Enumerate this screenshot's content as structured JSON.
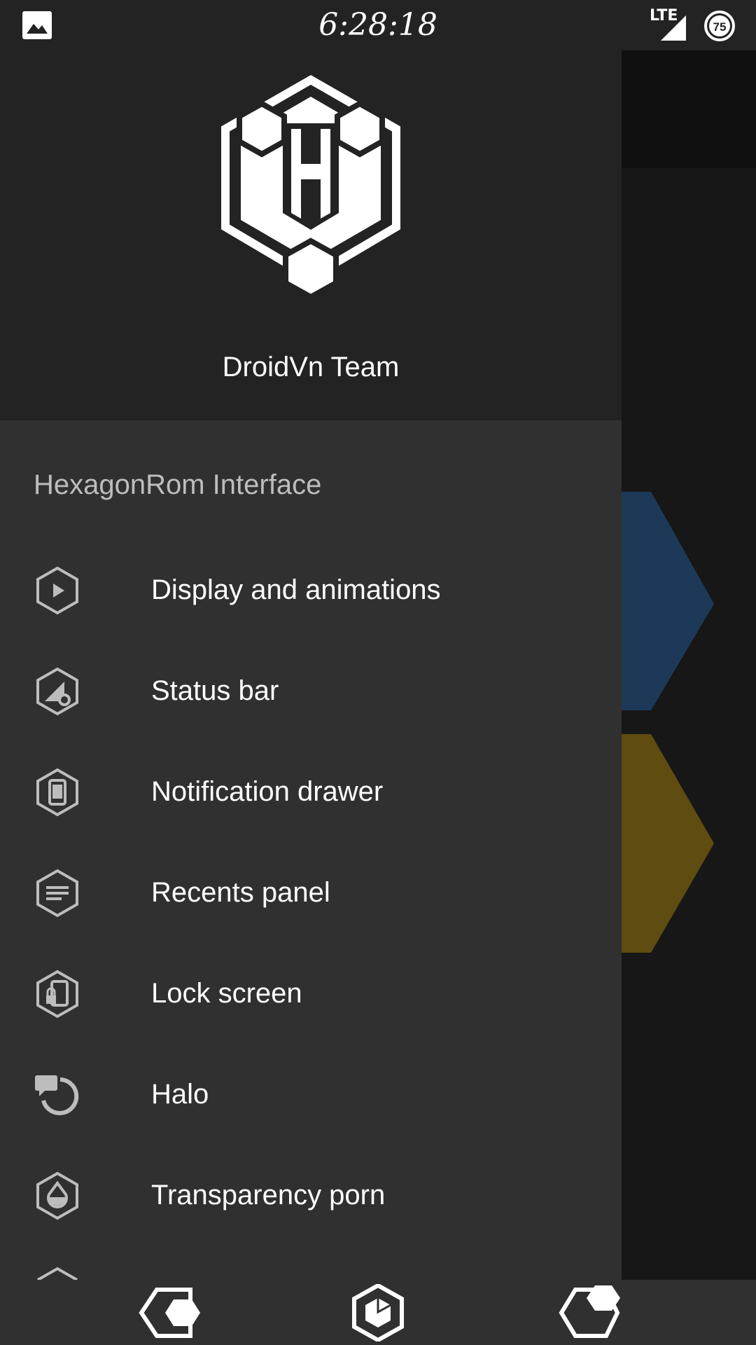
{
  "status_bar": {
    "time": "6:28:18",
    "network": "LTE",
    "battery": "75",
    "notification_icon": "image-icon"
  },
  "drawer": {
    "header": {
      "logo": "hexagon-h-logo",
      "team_name": "DroidVn Team"
    },
    "section_title": "HexagonRom Interface",
    "items": [
      {
        "label": "Display and animations",
        "icon": "play-hex-icon"
      },
      {
        "label": "Status bar",
        "icon": "signal-gear-hex-icon"
      },
      {
        "label": "Notification drawer",
        "icon": "phone-hex-icon"
      },
      {
        "label": "Recents panel",
        "icon": "lines-hex-icon"
      },
      {
        "label": "Lock screen",
        "icon": "phone-lock-hex-icon"
      },
      {
        "label": "Halo",
        "icon": "halo-icon"
      },
      {
        "label": "Transparency porn",
        "icon": "drop-hex-icon"
      }
    ]
  },
  "navbar": {
    "back": "back-hex-icon",
    "home": "home-hex-icon",
    "recents": "recents-hex-icon"
  },
  "colors": {
    "drawer_bg": "#303030",
    "header_bg": "#232323",
    "blue_tile": "#1c3a57",
    "gold_tile": "#5f4c10"
  }
}
